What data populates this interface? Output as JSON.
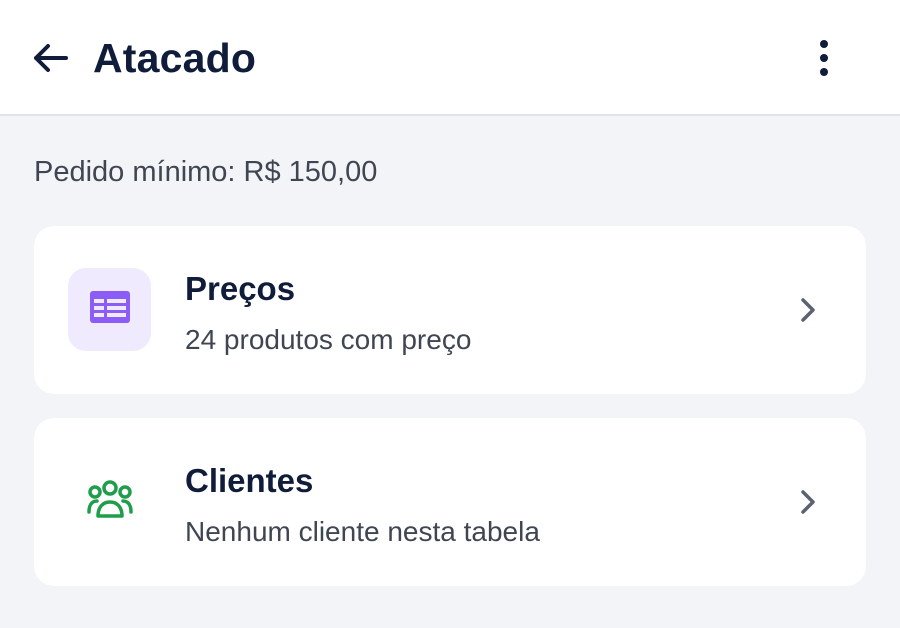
{
  "header": {
    "title": "Atacado",
    "back_icon": "arrow-left-icon",
    "menu_icon": "more-vertical-icon"
  },
  "summary": {
    "min_order": "Pedido mínimo: R$ 150,00"
  },
  "cards": [
    {
      "title": "Preços",
      "subtitle": "24 produtos com preço",
      "icon": "price-table-icon",
      "icon_color": "#8b5cf6",
      "icon_bg": "#efeafe"
    },
    {
      "title": "Clientes",
      "subtitle": "Nenhum cliente nesta tabela",
      "icon": "group-users-icon",
      "icon_color": "#1f9d4a"
    }
  ],
  "colors": {
    "text_primary": "#0f1c3a",
    "text_secondary": "#3f4652",
    "background": "#f3f4f8",
    "chevron": "#5b6270"
  }
}
